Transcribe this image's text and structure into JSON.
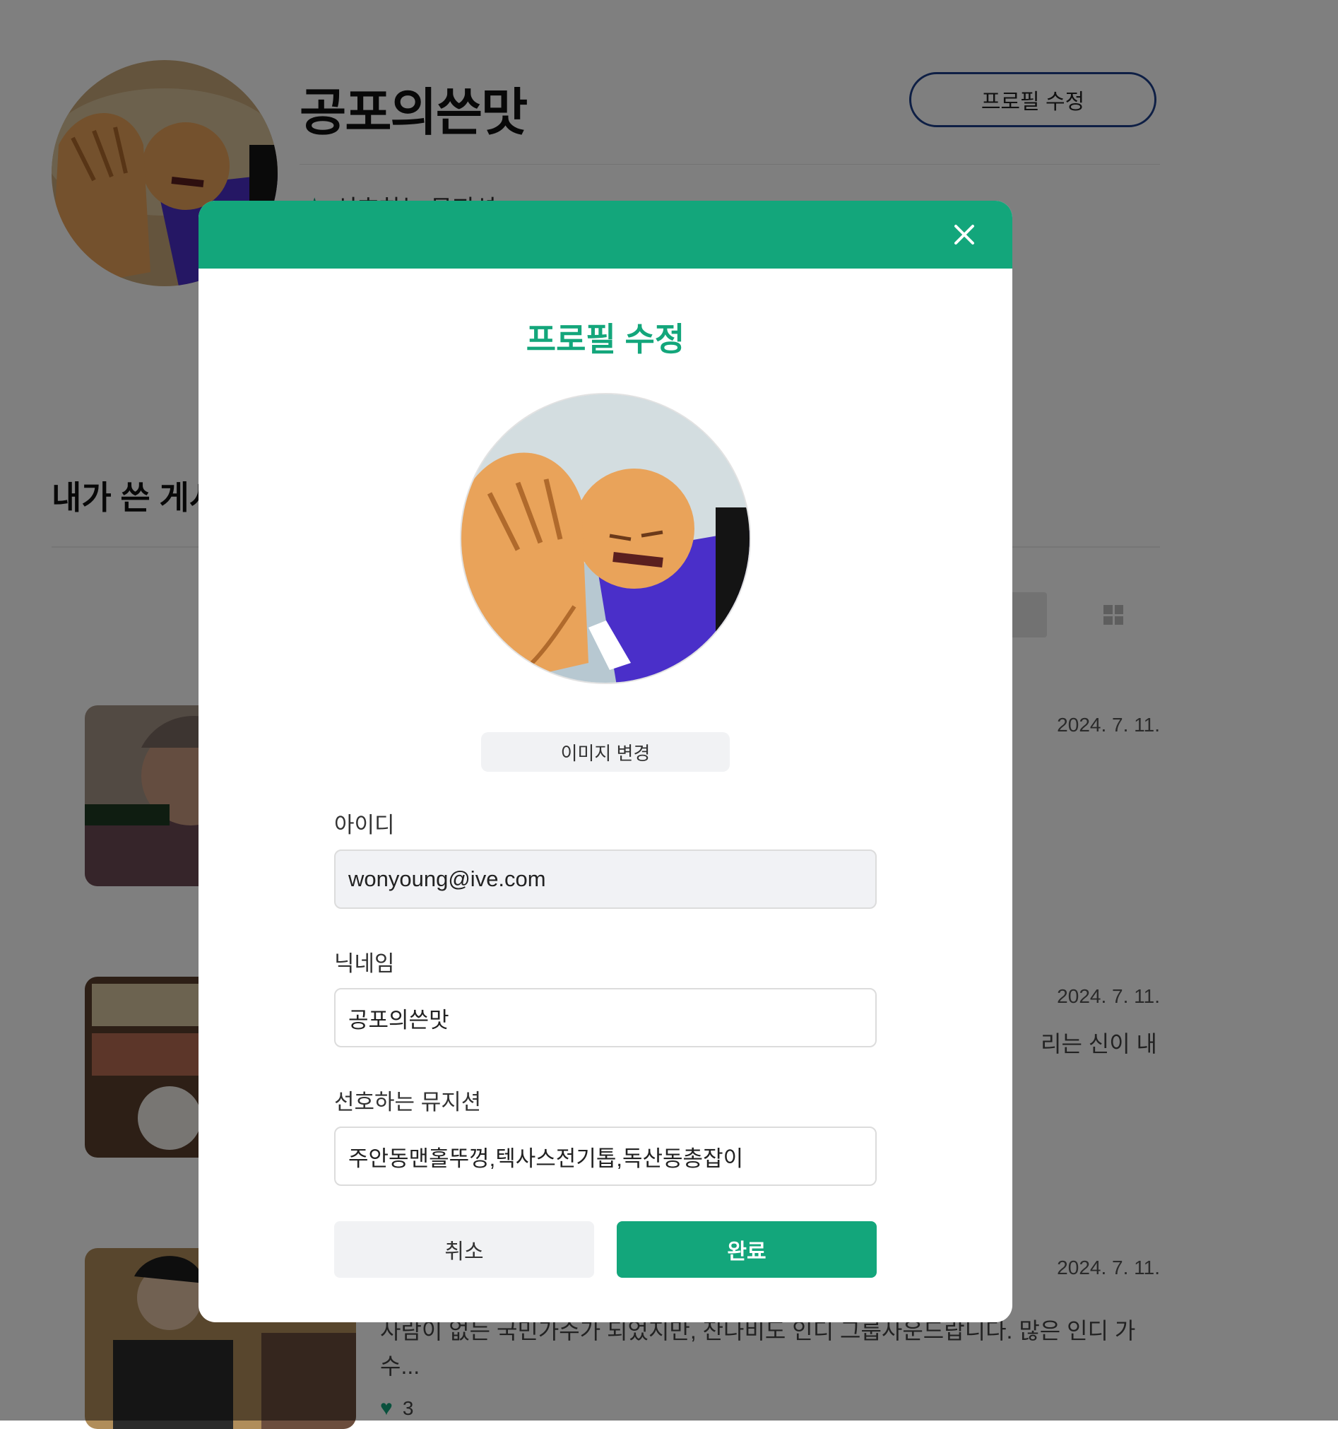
{
  "background": {
    "profile": {
      "name": "공포의쓴맛",
      "edit_button": "프로필 수정",
      "preferred_label": "선호하는 뮤지션"
    },
    "section_title": "내가 쓴 게시",
    "posts": [
      {
        "date": "2024. 7. 11.",
        "excerpt": "",
        "likes": ""
      },
      {
        "date": "2024. 7. 11.",
        "excerpt": "리는 신이 내",
        "likes": ""
      },
      {
        "date": "2024. 7. 11.",
        "excerpt": "사람이 없는 국민가수가 되었지만, 잔나비도 인디 그룹사운드랍니다. 많은 인디 가수...",
        "likes": "3"
      }
    ]
  },
  "modal": {
    "title": "프로필 수정",
    "change_image": "이미지 변경",
    "fields": {
      "id": {
        "label": "아이디",
        "value": "wonyoung@ive.com"
      },
      "nickname": {
        "label": "닉네임",
        "value": "공포의쓴맛"
      },
      "musicians": {
        "label": "선호하는 뮤지션",
        "value": "주안동맨홀뚜껑,텍사스전기톱,독산동총잡이"
      }
    },
    "cancel": "취소",
    "done": "완료"
  },
  "colors": {
    "accent": "#13a67b",
    "overlay": "rgba(0,0,0,0.5)",
    "button_border": "#1d3f8a"
  }
}
